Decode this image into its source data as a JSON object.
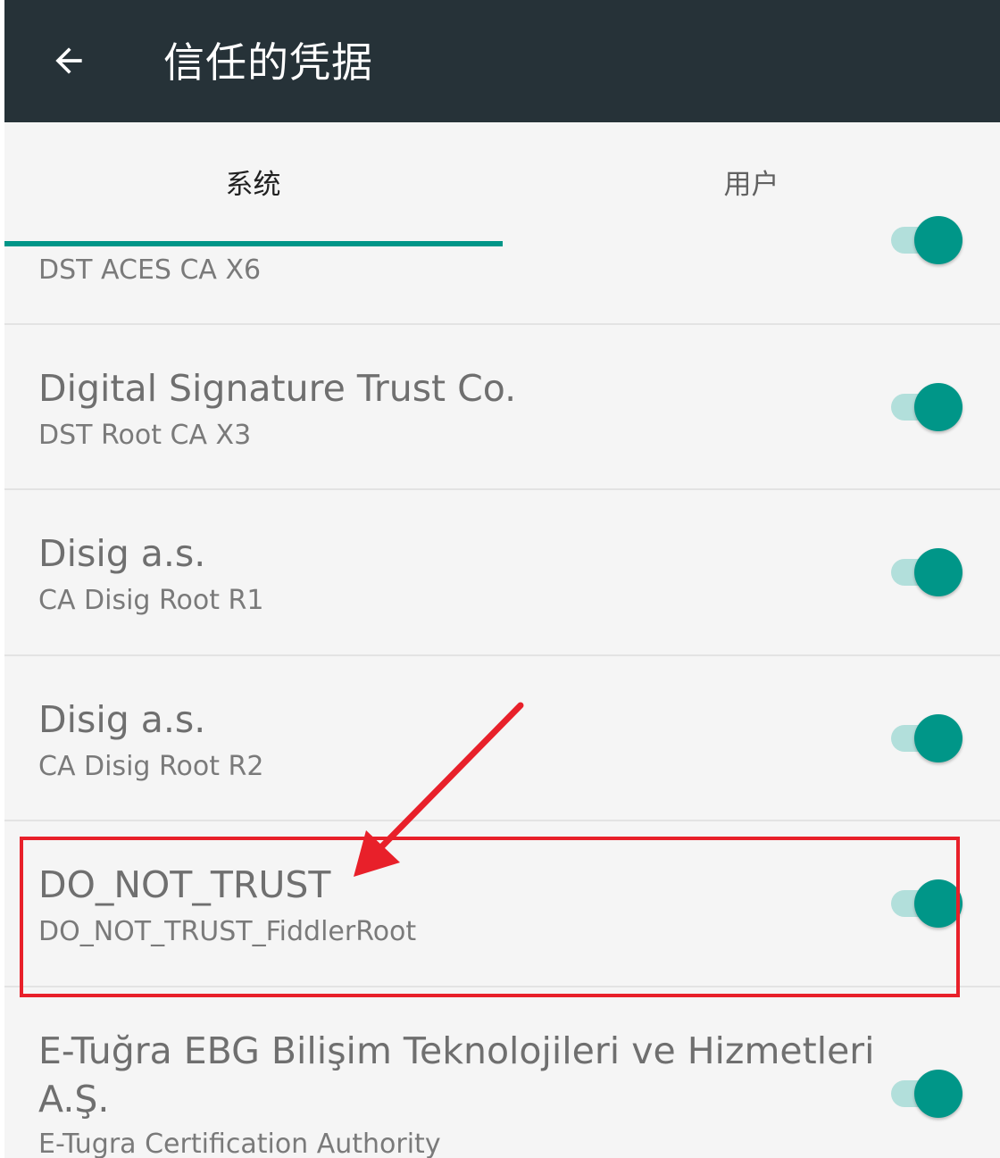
{
  "appbar": {
    "title": "信任的凭据",
    "back_icon": "arrow-back-icon"
  },
  "tabs": [
    {
      "label": "系统",
      "selected": true
    },
    {
      "label": "用户",
      "selected": false
    }
  ],
  "list": {
    "items": [
      {
        "title": "",
        "subtitle": "DST ACES CA X6",
        "enabled": true
      },
      {
        "title": "Digital Signature Trust Co.",
        "subtitle": "DST Root CA X3",
        "enabled": true
      },
      {
        "title": "Disig a.s.",
        "subtitle": "CA Disig Root R1",
        "enabled": true
      },
      {
        "title": "Disig a.s.",
        "subtitle": "CA Disig Root R2",
        "enabled": true
      },
      {
        "title": "DO_NOT_TRUST",
        "subtitle": "DO_NOT_TRUST_FiddlerRoot",
        "enabled": true
      },
      {
        "title_line1": "E-Tuğra EBG Bilişim Teknolojileri ve Hizmetleri",
        "title_line2": "A.Ş.",
        "subtitle": "E-Tugra Certification Authority",
        "enabled": true
      }
    ]
  },
  "colors": {
    "appbar": "#263238",
    "accent": "#009688",
    "switch_track": "#b2dfdb",
    "highlight": "#e8202a",
    "background": "#f5f5f5"
  },
  "annotation": {
    "highlight_icon": "red-highlight-box",
    "arrow_icon": "red-arrow-icon"
  }
}
